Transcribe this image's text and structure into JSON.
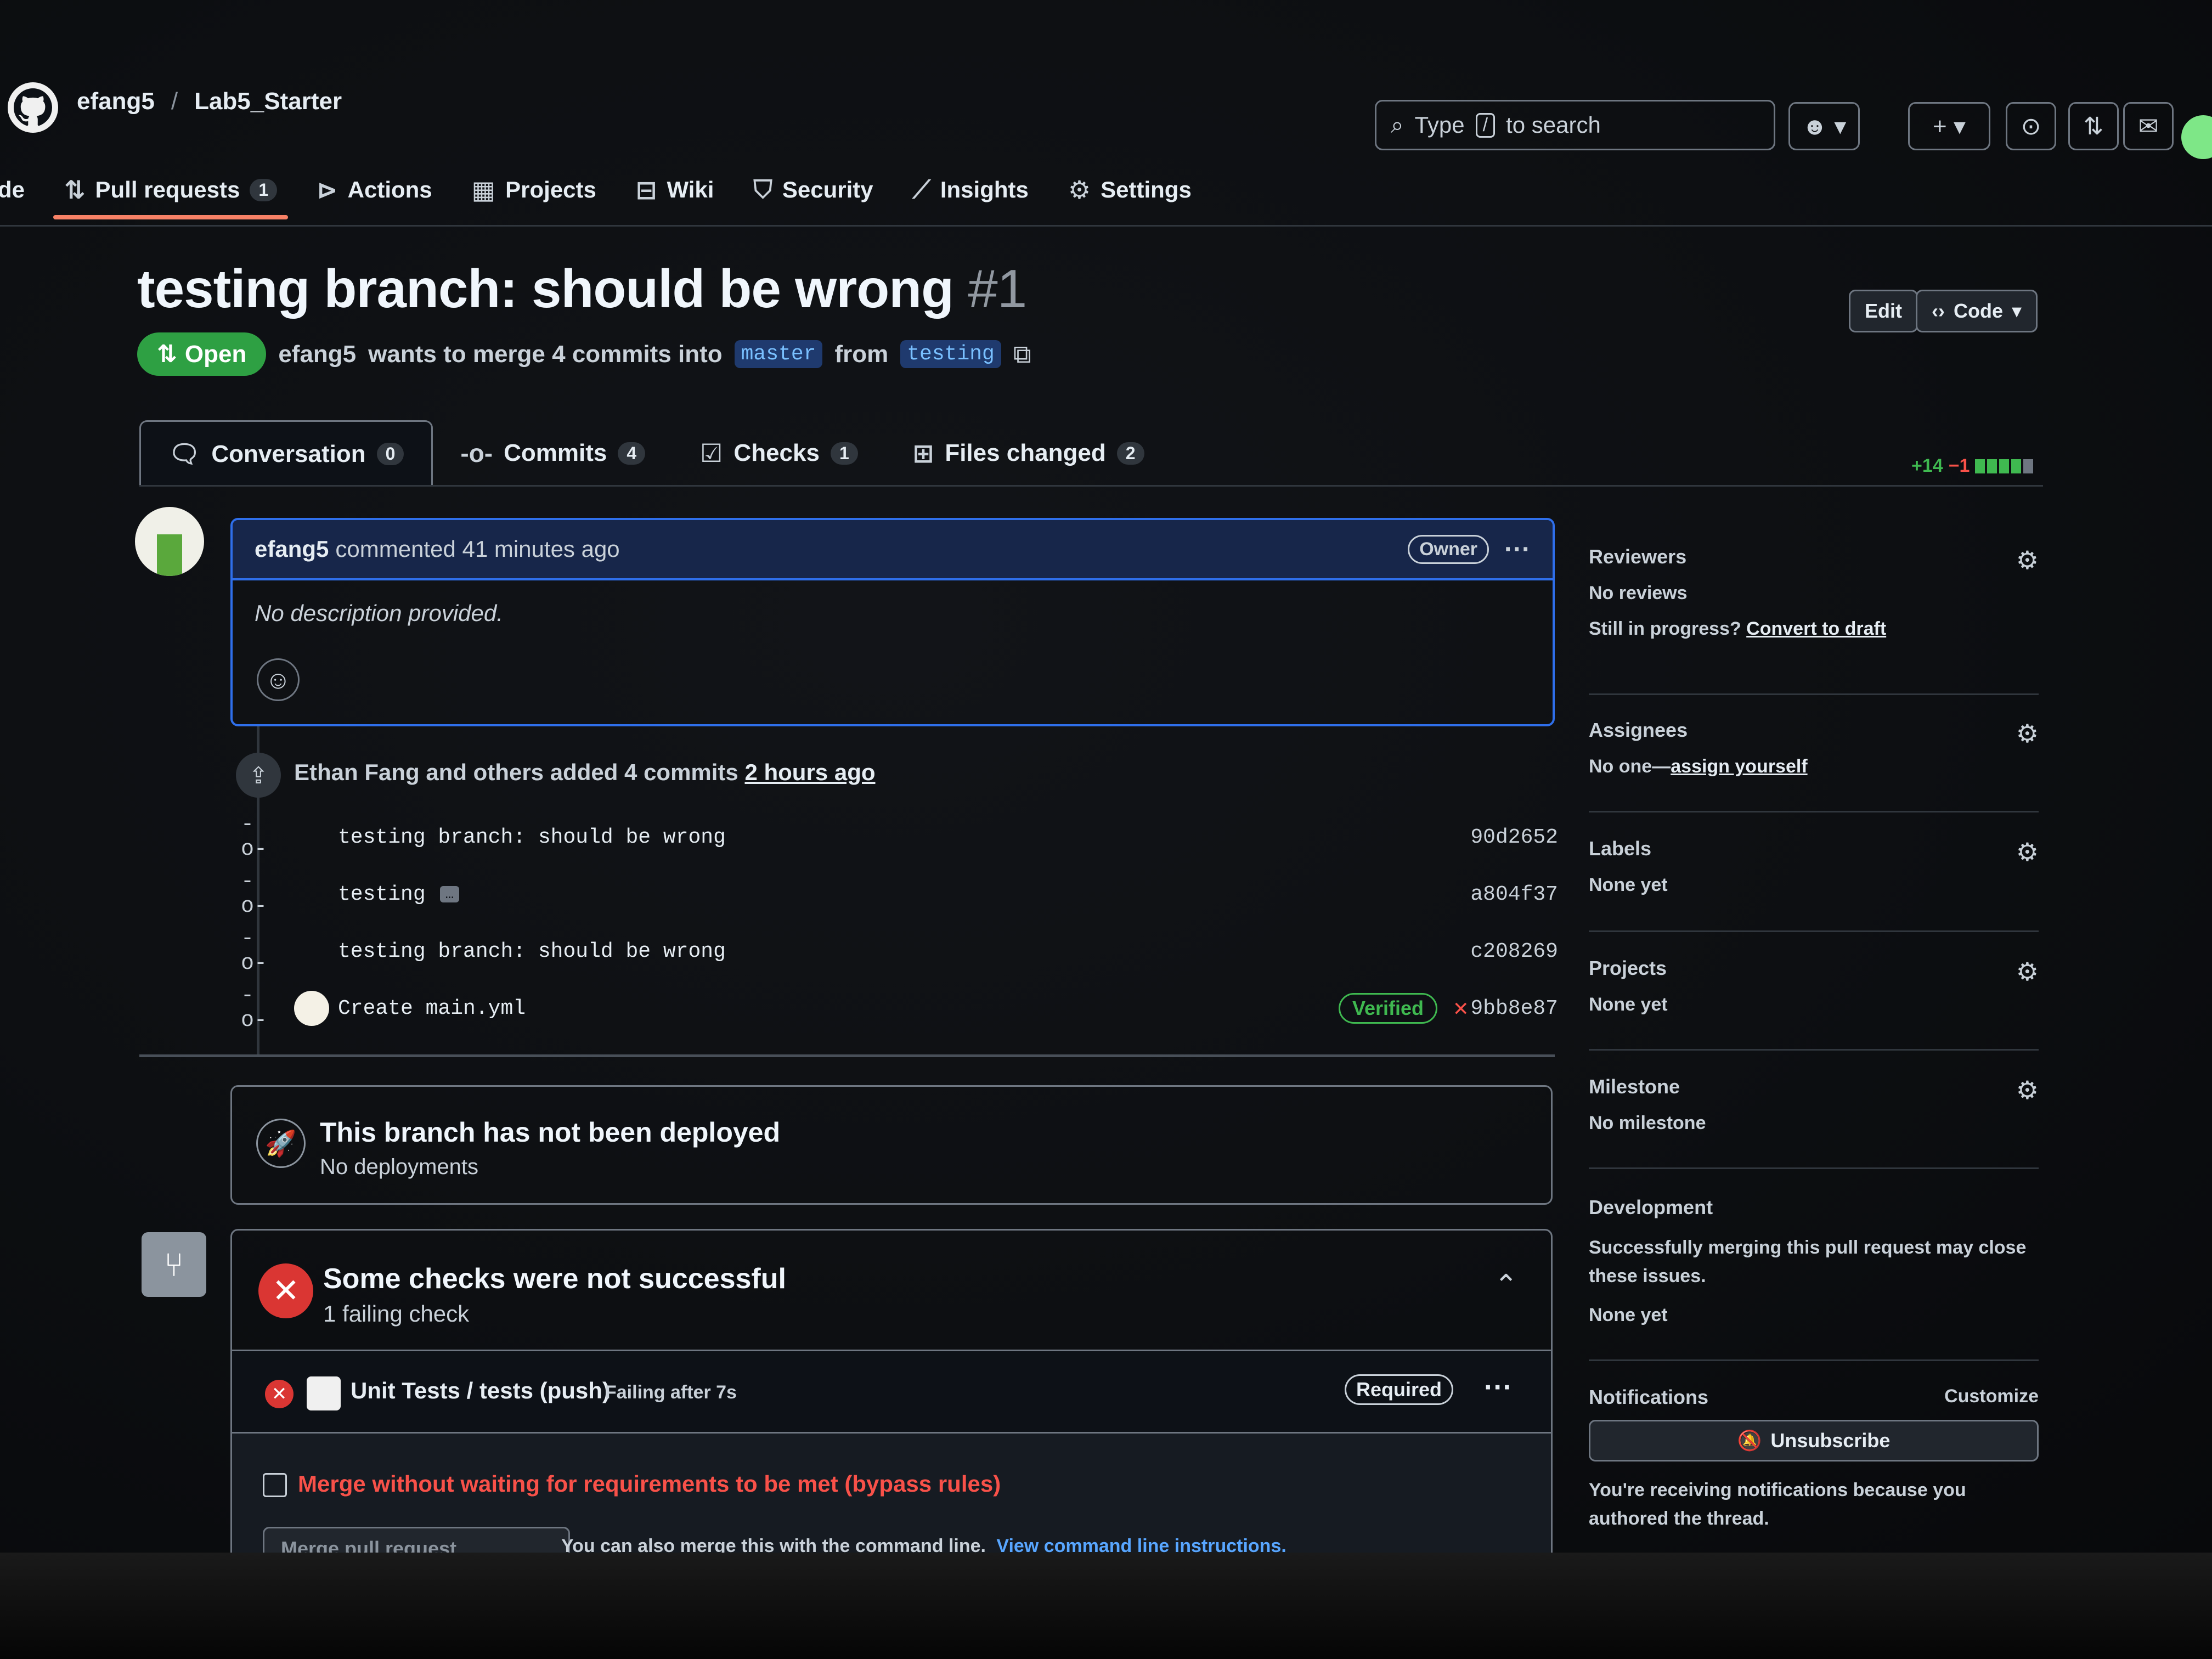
{
  "header": {
    "owner": "efang5",
    "separator": "/",
    "repo": "Lab5_Starter",
    "search": {
      "prefix": "Type",
      "key": "/",
      "suffix": "to search"
    }
  },
  "repo_nav": [
    {
      "label": "Code",
      "icon": "code-icon"
    },
    {
      "label": "Pull requests",
      "icon": "git-pull-request-icon",
      "count": "1",
      "selected": true
    },
    {
      "label": "Actions",
      "icon": "play-icon"
    },
    {
      "label": "Projects",
      "icon": "table-icon"
    },
    {
      "label": "Wiki",
      "icon": "book-icon"
    },
    {
      "label": "Security",
      "icon": "shield-icon"
    },
    {
      "label": "Insights",
      "icon": "graph-icon"
    },
    {
      "label": "Settings",
      "icon": "gear-icon"
    }
  ],
  "pr": {
    "title": "testing branch: should be wrong",
    "number": "#1",
    "edit_label": "Edit",
    "code_label": "Code",
    "state": "Open",
    "author": "efang5",
    "meta_text": "wants to merge 4 commits into",
    "base_branch": "master",
    "from_text": "from",
    "head_branch": "testing"
  },
  "tabs": [
    {
      "label": "Conversation",
      "count": "0",
      "active": true
    },
    {
      "label": "Commits",
      "count": "4"
    },
    {
      "label": "Checks",
      "count": "1"
    },
    {
      "label": "Files changed",
      "count": "2"
    }
  ],
  "diffstat": {
    "additions": "+14",
    "deletions": "−1",
    "blocks_green": 4,
    "blocks_grey": 1
  },
  "comment": {
    "author": "efang5",
    "action": "commented 41 minutes ago",
    "badge": "Owner",
    "body": "No description provided."
  },
  "timeline": {
    "summary_prefix": "Ethan Fang and others added 4 commits",
    "summary_time": "2 hours ago",
    "commits": [
      {
        "message": "testing branch: should be wrong",
        "sha": "90d2652"
      },
      {
        "message": "testing",
        "sha": "a804f37",
        "ellipsis": "…"
      },
      {
        "message": "testing branch: should be wrong",
        "sha": "c208269"
      },
      {
        "message": "Create main.yml",
        "sha": "9bb8e87",
        "verified": "Verified"
      }
    ]
  },
  "deploy": {
    "title": "This branch has not been deployed",
    "subtitle": "No deployments"
  },
  "merge": {
    "title": "Some checks were not successful",
    "subtitle": "1 failing check",
    "check_name": "Unit Tests / tests (push)",
    "check_status": "Failing after 7s",
    "required": "Required",
    "bypass": "Merge without waiting for requirements to be met (bypass rules)",
    "merge_button": "Merge pull request",
    "cmdline_text": "You can also merge this with the command line.",
    "cmdline_link": "View command line instructions."
  },
  "sidebar": {
    "reviewers": {
      "label": "Reviewers",
      "value": "No reviews",
      "draft_prefix": "Still in progress?",
      "draft_link": "Convert to draft"
    },
    "assignees": {
      "label": "Assignees",
      "value_prefix": "No one—",
      "value_link": "assign yourself"
    },
    "labels": {
      "label": "Labels",
      "value": "None yet"
    },
    "projects": {
      "label": "Projects",
      "value": "None yet"
    },
    "milestone": {
      "label": "Milestone",
      "value": "No milestone"
    },
    "development": {
      "label": "Development",
      "desc": "Successfully merging this pull request may close these issues.",
      "value": "None yet"
    },
    "notifications": {
      "label": "Notifications",
      "customize": "Customize",
      "button": "Unsubscribe",
      "reason": "You're receiving notifications because you authored the thread."
    }
  }
}
